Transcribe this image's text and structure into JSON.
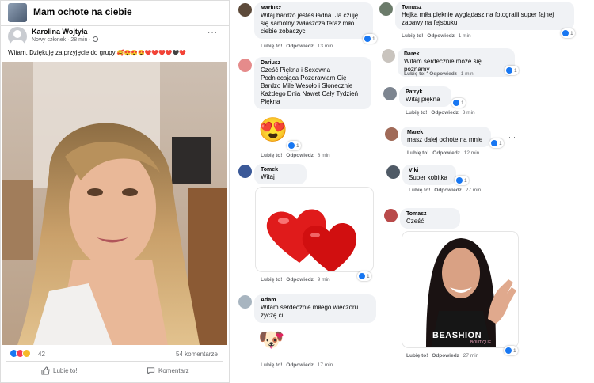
{
  "group": {
    "title": "Mam ochote na ciebie"
  },
  "post": {
    "author": "Karolina Wojtyła",
    "meta": "Nowy członek · 28 min ·",
    "more": "···",
    "text": "Witam. Dziękuję za przyjęcie do grupy",
    "text_emojis": "🥰😍😍😍❤️❤️❤️❤️🖤❤️",
    "reactions_count": "42",
    "comments_count": "54 komentarze",
    "like_label": "Lubię to!",
    "comment_label": "Komentarz"
  },
  "icons": {
    "like": "like-icon",
    "love": "love-icon",
    "wow": "wow-icon",
    "comment": "comment-icon",
    "globe": "globe-icon"
  },
  "colors": {
    "accent": "#1877f2",
    "love": "#f33e58",
    "bubble": "#f0f2f5",
    "muted": "#65676b"
  },
  "left_comments": [
    {
      "name": "Mariusz",
      "text": [
        "Witaj bardzo jesteś ładna. Ja czuję",
        "się samotny zwłaszcza teraz miło",
        "ciebie zobaczyc"
      ],
      "like": "Lubię to!",
      "reply": "Odpowiedz",
      "time": "13 min",
      "reactions": "1"
    },
    {
      "name": "Dariusz",
      "text": [
        "Cześć Piękna i Sexowna",
        "Podniecająca Pozdrawiam Cię",
        "Bardzo Mile Wesoło i Słonecznie",
        "Każdego Dnia Nawet Cały Tydzień",
        "Piękna"
      ],
      "sticker": "😍",
      "like": "Lubię to!",
      "reply": "Odpowiedz",
      "time": "8 min",
      "reactions": "1"
    },
    {
      "name": "Tomek",
      "text": [
        "Witaj"
      ],
      "like": "Lubię to!",
      "reply": "Odpowiedz",
      "time": "9 min",
      "reactions": "1"
    },
    {
      "name": "Adam",
      "text": [
        "Witam serdecznie miłego wieczoru",
        "życzę ci"
      ],
      "sticker": "🐶",
      "like": "Lubię to!",
      "reply": "Odpowiedz",
      "time": "17 min",
      "reactions": ""
    }
  ],
  "right_comments": [
    {
      "name": "Tomasz",
      "text": [
        "Hejka miła pięknie wyglądasz na fotografii super fajnej",
        "zabawy na fejsbuku"
      ],
      "like": "Lubię to!",
      "reply": "Odpowiedz",
      "time": "1 min",
      "reactions": "1"
    },
    {
      "name": "Darek",
      "text": [
        "Witam serdecznie może się poznamy"
      ],
      "like": "Lubię to!",
      "reply": "Odpowiedz",
      "time": "1 min",
      "reactions": "1"
    },
    {
      "name": "Patryk",
      "text": [
        "Witaj piękna"
      ],
      "like": "Lubię to!",
      "reply": "Odpowiedz",
      "time": "3 min",
      "reactions": "1"
    },
    {
      "name": "Marek",
      "text": [
        "masz dalej ochote na mnie"
      ],
      "like": "Lubię to!",
      "reply": "Odpowiedz",
      "time": "12 min",
      "reactions": "1",
      "more": "···"
    },
    {
      "name": "Viki",
      "text": [
        "Super kobitka"
      ],
      "like": "Lubię to!",
      "reply": "Odpowiedz",
      "time": "27 min",
      "reactions": "1"
    },
    {
      "name": "Tomasz",
      "text": [
        "Cześć"
      ],
      "like": "Lubię to!",
      "reply": "Odpowiedz",
      "time": "27 min",
      "reactions": "1"
    }
  ],
  "beashion": {
    "brand": "BEASHION",
    "sub": "BOUTIQUE"
  }
}
